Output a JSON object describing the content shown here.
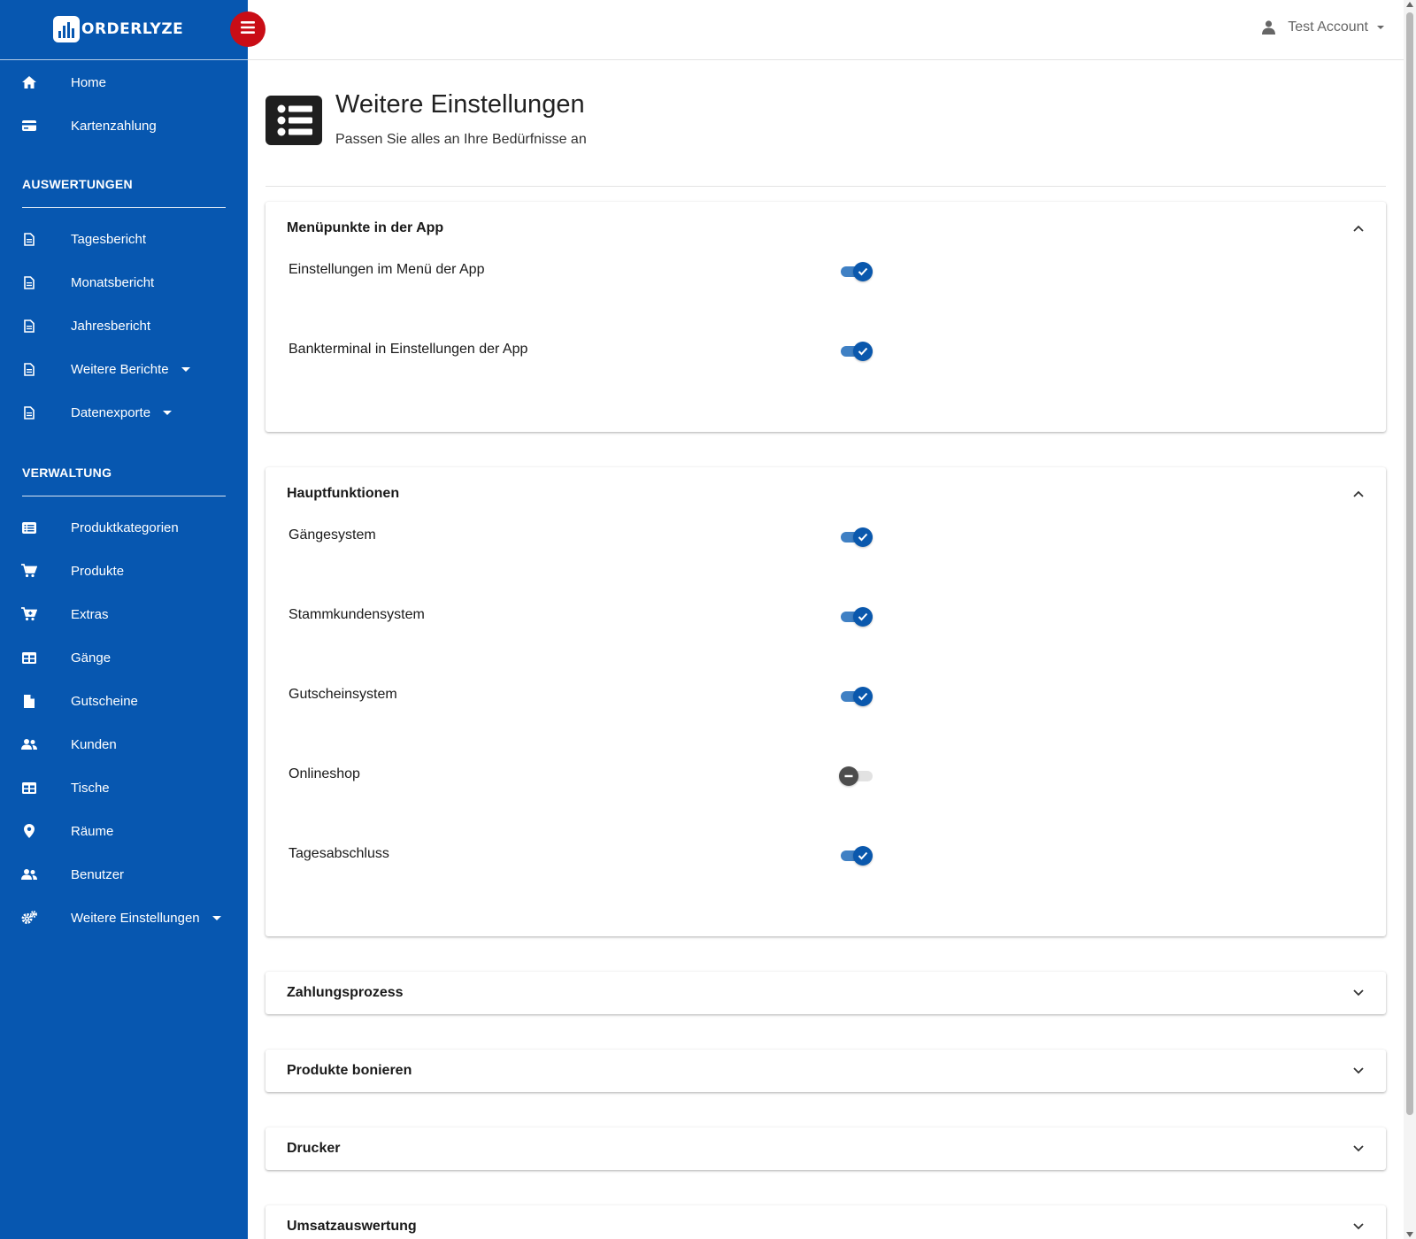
{
  "app": {
    "brand": "ORDERLYZE"
  },
  "header": {
    "account_label": "Test Account"
  },
  "sidebar": {
    "top_items": [
      {
        "label": "Home",
        "icon": "home-icon"
      },
      {
        "label": "Kartenzahlung",
        "icon": "credit-card-icon"
      }
    ],
    "sections": [
      {
        "title": "AUSWERTUNGEN",
        "items": [
          {
            "label": "Tagesbericht",
            "icon": "document-icon"
          },
          {
            "label": "Monatsbericht",
            "icon": "document-icon"
          },
          {
            "label": "Jahresbericht",
            "icon": "document-icon"
          },
          {
            "label": "Weitere Berichte",
            "icon": "document-icon",
            "dropdown": true
          },
          {
            "label": "Datenexporte",
            "icon": "document-icon",
            "dropdown": true
          }
        ]
      },
      {
        "title": "VERWALTUNG",
        "items": [
          {
            "label": "Produktkategorien",
            "icon": "list-icon"
          },
          {
            "label": "Produkte",
            "icon": "cart-icon"
          },
          {
            "label": "Extras",
            "icon": "cart-plus-icon"
          },
          {
            "label": "Gänge",
            "icon": "table-icon"
          },
          {
            "label": "Gutscheine",
            "icon": "file-icon"
          },
          {
            "label": "Kunden",
            "icon": "users-icon"
          },
          {
            "label": "Tische",
            "icon": "table-icon"
          },
          {
            "label": "Räume",
            "icon": "map-marker-icon"
          },
          {
            "label": "Benutzer",
            "icon": "users-icon"
          },
          {
            "label": "Weitere Einstellungen",
            "icon": "cogs-icon",
            "dropdown": true
          }
        ]
      }
    ]
  },
  "page": {
    "title": "Weitere Einstellungen",
    "subtitle": "Passen Sie alles an Ihre Bedürfnisse an"
  },
  "cards": [
    {
      "title": "Menüpunkte in der App",
      "expanded": true,
      "settings": [
        {
          "label": "Einstellungen im Menü der App",
          "enabled": true
        },
        {
          "label": "Bankterminal in Einstellungen der App",
          "enabled": true
        }
      ]
    },
    {
      "title": "Hauptfunktionen",
      "expanded": true,
      "settings": [
        {
          "label": "Gängesystem",
          "enabled": true
        },
        {
          "label": "Stammkundensystem",
          "enabled": true
        },
        {
          "label": "Gutscheinsystem",
          "enabled": true
        },
        {
          "label": "Onlineshop",
          "enabled": false
        },
        {
          "label": "Tagesabschluss",
          "enabled": true
        }
      ]
    },
    {
      "title": "Zahlungsprozess",
      "expanded": false,
      "settings": []
    },
    {
      "title": "Produkte bonieren",
      "expanded": false,
      "settings": []
    },
    {
      "title": "Drucker",
      "expanded": false,
      "settings": []
    },
    {
      "title": "Umsatzauswertung",
      "expanded": false,
      "settings": []
    }
  ],
  "colors": {
    "sidebar_bg": "#0757b0",
    "menu_toggle": "#c90d16",
    "toggle_on": "#0a58ad",
    "toggle_off": "#4d4d4d"
  }
}
